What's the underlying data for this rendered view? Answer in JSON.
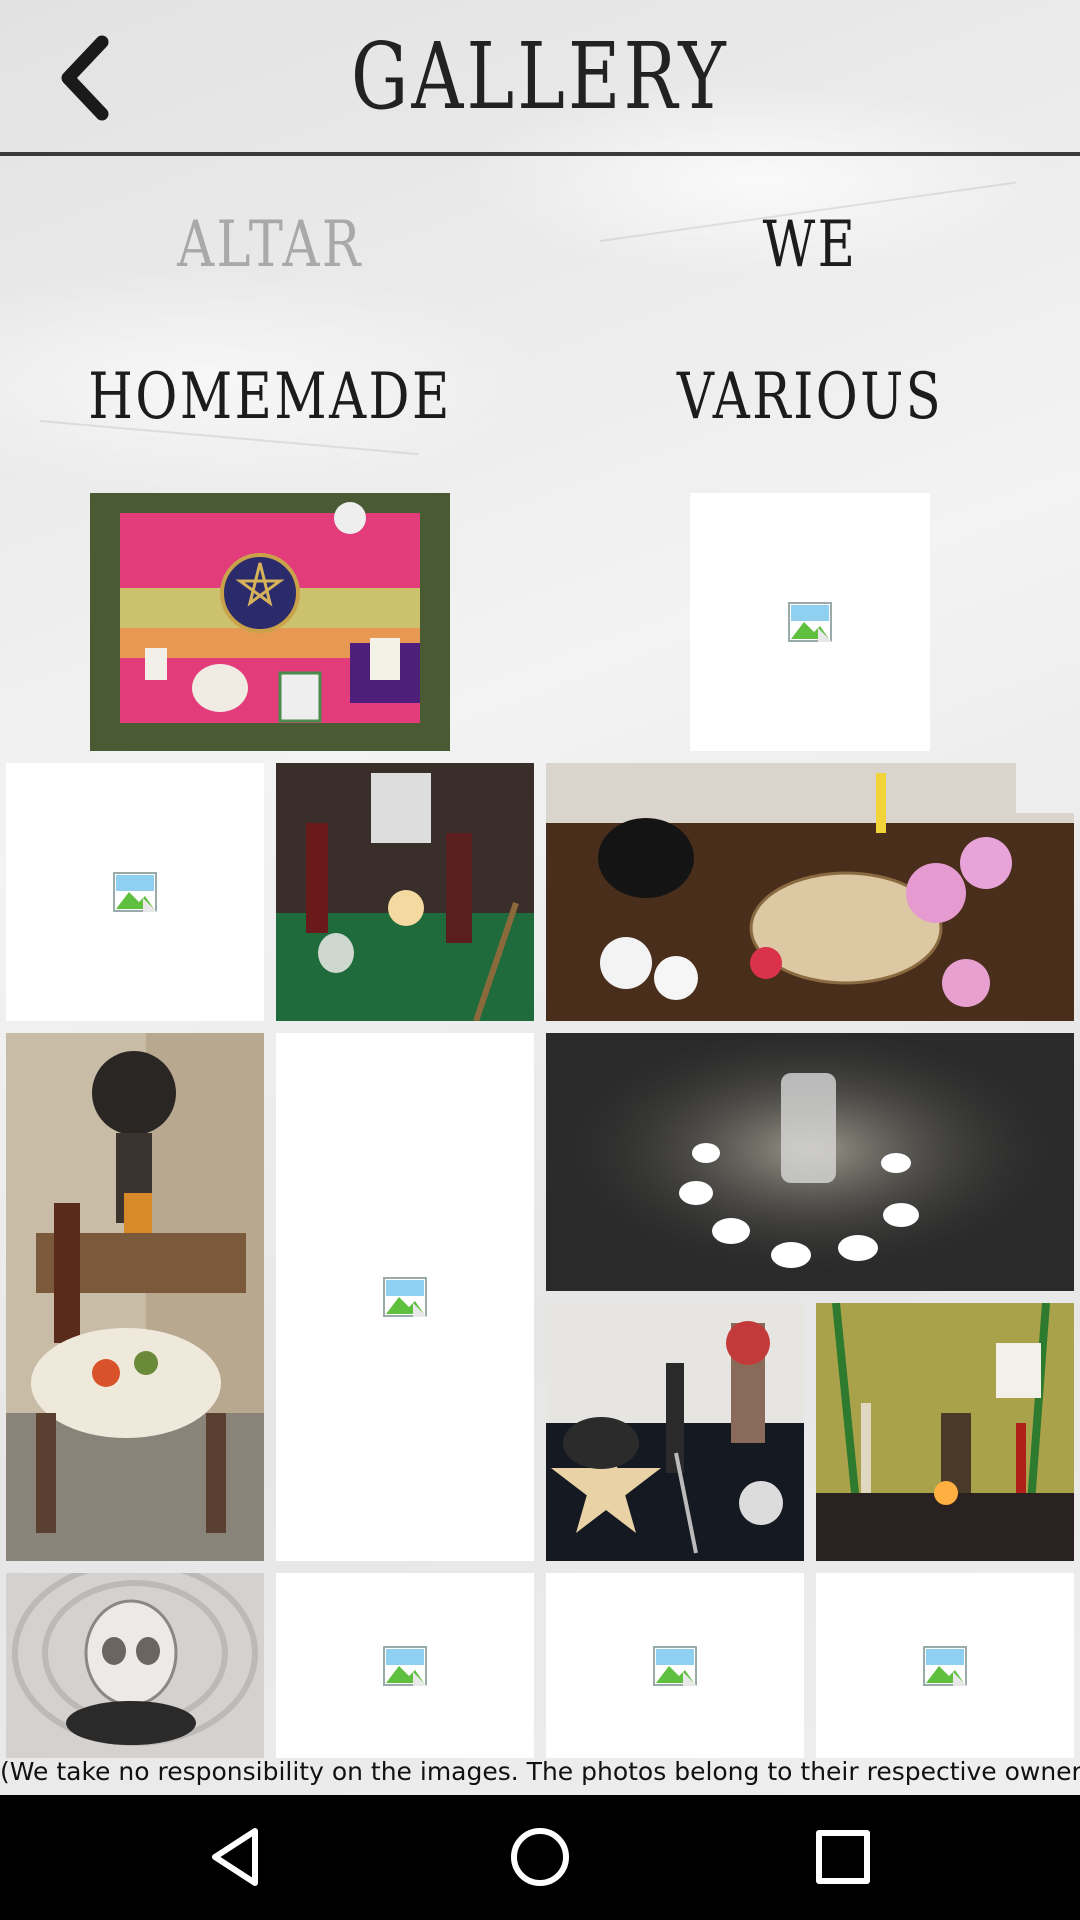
{
  "header": {
    "title": "GALLERY",
    "back_icon": "chevron-left-icon"
  },
  "tabs": [
    {
      "label": "ALTAR",
      "state": "inactive"
    },
    {
      "label": "WE",
      "state": "active"
    },
    {
      "label": "HOMEMADE",
      "state": "active"
    },
    {
      "label": "VARIOUS",
      "state": "active"
    }
  ],
  "gallery": {
    "photos": [
      {
        "name": "altar-cloth-photo",
        "kind": "image"
      },
      {
        "name": "broken-image-1",
        "kind": "broken"
      },
      {
        "name": "broken-image-2",
        "kind": "broken"
      },
      {
        "name": "green-altar-photo",
        "kind": "image"
      },
      {
        "name": "flower-altar-photo",
        "kind": "image"
      },
      {
        "name": "table-altar-photo",
        "kind": "image"
      },
      {
        "name": "broken-image-3",
        "kind": "broken"
      },
      {
        "name": "candle-circle-photo",
        "kind": "image"
      },
      {
        "name": "pentacle-altar-photo",
        "kind": "image"
      },
      {
        "name": "candle-shelf-photo",
        "kind": "image"
      },
      {
        "name": "crystal-skull-photo",
        "kind": "image"
      },
      {
        "name": "broken-image-4",
        "kind": "broken"
      },
      {
        "name": "broken-image-5",
        "kind": "broken"
      },
      {
        "name": "broken-image-6",
        "kind": "broken"
      }
    ]
  },
  "disclaimer": "(We take no responsibility on the images. The photos belong to their respective owners.)",
  "navbar": {
    "back_icon": "triangle-back-icon",
    "home_icon": "circle-home-icon",
    "recents_icon": "square-recents-icon"
  },
  "colors": {
    "header_line": "#3a3a3a",
    "tab_inactive": "#a9a9a9",
    "tab_active": "#1c1c1c",
    "navbar": "#000000"
  }
}
